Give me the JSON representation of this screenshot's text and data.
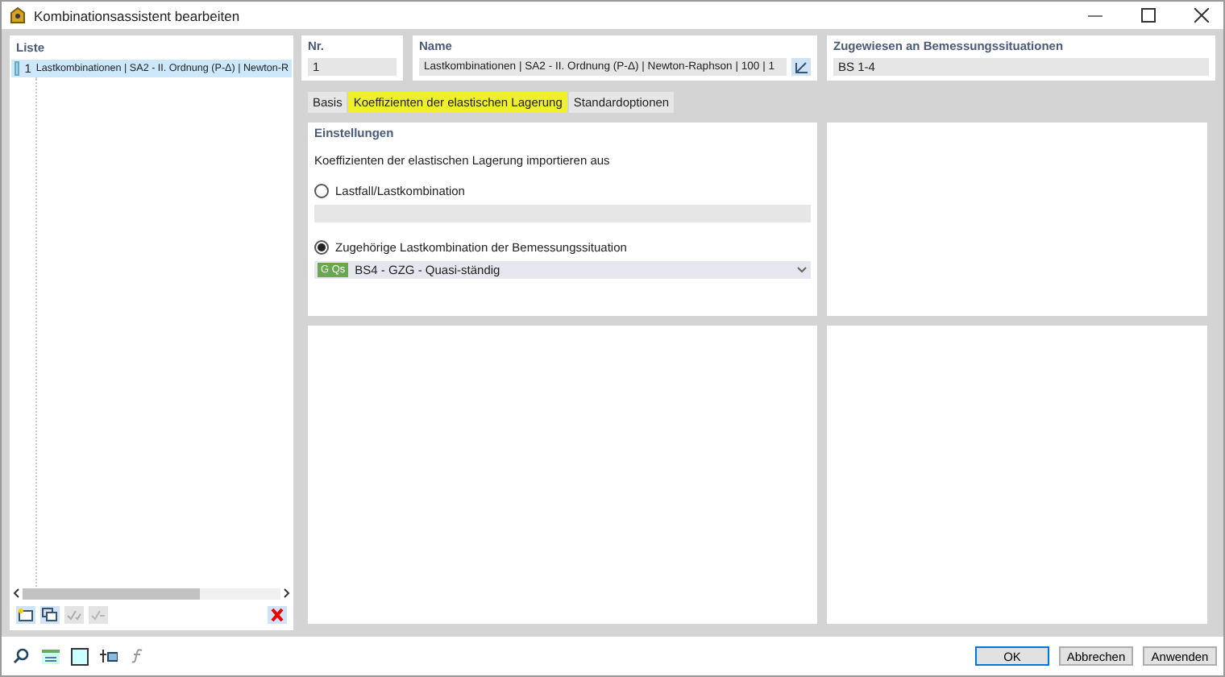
{
  "window": {
    "title": "Kombinationsassistent bearbeiten"
  },
  "list": {
    "title": "Liste",
    "items": [
      {
        "number": "1",
        "label": "Lastkombinationen | SA2 - II. Ordnung (P-Δ) | Newton-R",
        "selected": true
      }
    ],
    "toolbar": [
      {
        "disabled": false
      },
      {
        "disabled": false
      },
      {
        "disabled": true
      },
      {
        "disabled": true
      },
      {
        "disabled": false
      }
    ]
  },
  "nr": {
    "label": "Nr.",
    "value": "1"
  },
  "name": {
    "label": "Name",
    "value": "Lastkombinationen | SA2 - II. Ordnung (P-Δ) | Newton-Raphson | 100 | 1"
  },
  "assigned": {
    "label": "Zugewiesen an Bemessungssituationen",
    "value": "BS 1-4"
  },
  "tabs": [
    {
      "label": "Basis",
      "selected": false
    },
    {
      "label": "Koeffizienten der elastischen Lagerung",
      "selected": true
    },
    {
      "label": "Standardoptionen",
      "selected": false
    }
  ],
  "settings": {
    "title": "Einstellungen",
    "intro": "Koeffizienten der elastischen Lagerung importieren aus",
    "options": [
      {
        "label": "Lastfall/Lastkombination",
        "selected": false
      },
      {
        "label": "Zugehörige Lastkombination der Bemessungssituation",
        "selected": true,
        "badge": "G Qs",
        "value": "BS4 - GZG - Quasi-ständig"
      }
    ]
  },
  "buttons": [
    {
      "label": "OK",
      "default": true
    },
    {
      "label": "Abbrechen",
      "default": false
    },
    {
      "label": "Anwenden",
      "default": false
    }
  ]
}
